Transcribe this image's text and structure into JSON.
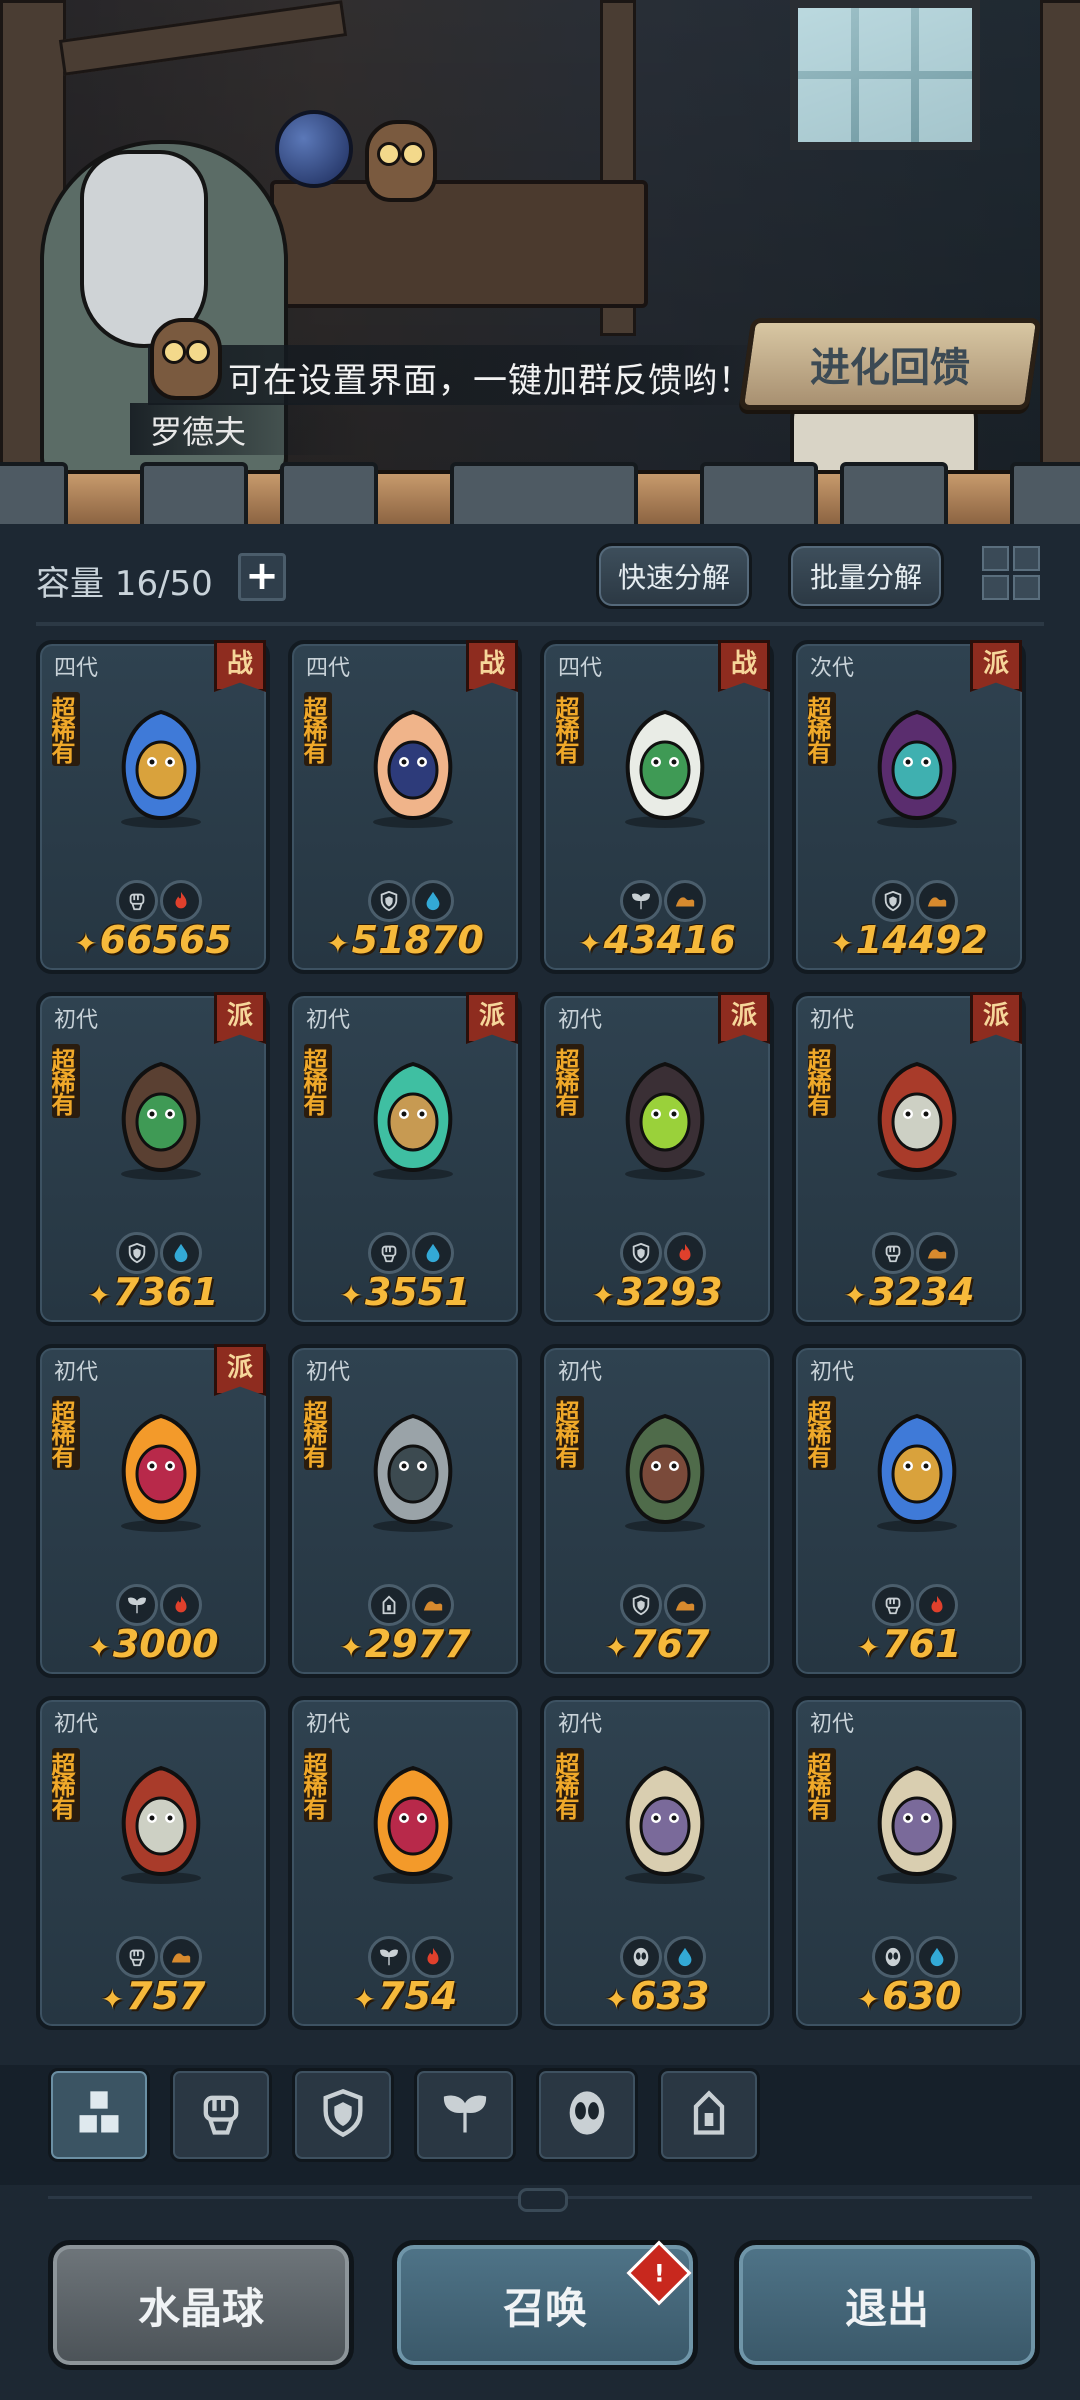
{
  "dialog": {
    "text": "可在设置界面，一键加群反馈哟！",
    "speaker": "罗德夫"
  },
  "evolution_button": "进化回馈",
  "toolbar": {
    "capacity_label": "容量 16/50",
    "quick_decompose": "快速分解",
    "batch_decompose": "批量分解"
  },
  "cards": [
    {
      "gen": "四代",
      "faction": "战",
      "rarity": "超稀有",
      "power": "66565",
      "elements": [
        "fist-icon",
        "fire-icon"
      ],
      "creature": "blue-flame-spirit"
    },
    {
      "gen": "四代",
      "faction": "战",
      "rarity": "超稀有",
      "power": "51870",
      "elements": [
        "shield-icon",
        "water-icon"
      ],
      "creature": "bunny-witch"
    },
    {
      "gen": "四代",
      "faction": "战",
      "rarity": "超稀有",
      "power": "43416",
      "elements": [
        "leaf-icon",
        "earth-icon"
      ],
      "creature": "white-owl-sage"
    },
    {
      "gen": "次代",
      "faction": "派",
      "rarity": "超稀有",
      "power": "14492",
      "elements": [
        "shield-icon",
        "earth-icon"
      ],
      "creature": "rose-dark-fairy"
    },
    {
      "gen": "初代",
      "faction": "派",
      "rarity": "超稀有",
      "power": "7361",
      "elements": [
        "shield-icon",
        "water-icon"
      ],
      "creature": "tree-spirit"
    },
    {
      "gen": "初代",
      "faction": "派",
      "rarity": "超稀有",
      "power": "3551",
      "elements": [
        "fist-icon",
        "water-icon"
      ],
      "creature": "water-serpent"
    },
    {
      "gen": "初代",
      "faction": "派",
      "rarity": "超稀有",
      "power": "3293",
      "elements": [
        "shield-icon",
        "fire-icon"
      ],
      "creature": "dark-beast"
    },
    {
      "gen": "初代",
      "faction": "派",
      "rarity": "超稀有",
      "power": "3234",
      "elements": [
        "fist-icon",
        "earth-icon"
      ],
      "creature": "hooded-blob"
    },
    {
      "gen": "初代",
      "faction": "派",
      "rarity": "超稀有",
      "power": "3000",
      "elements": [
        "leaf-icon",
        "fire-icon"
      ],
      "creature": "phoenix-fairy"
    },
    {
      "gen": "初代",
      "faction": "",
      "rarity": "超稀有",
      "power": "2977",
      "elements": [
        "tower-icon",
        "earth-icon"
      ],
      "creature": "armored-rat"
    },
    {
      "gen": "初代",
      "faction": "",
      "rarity": "超稀有",
      "power": "767",
      "elements": [
        "shield-icon",
        "earth-icon"
      ],
      "creature": "moss-golem"
    },
    {
      "gen": "初代",
      "faction": "",
      "rarity": "超稀有",
      "power": "761",
      "elements": [
        "fist-icon",
        "fire-icon"
      ],
      "creature": "blue-flame-spirit"
    },
    {
      "gen": "初代",
      "faction": "",
      "rarity": "超稀有",
      "power": "757",
      "elements": [
        "fist-icon",
        "earth-icon"
      ],
      "creature": "hooded-blob"
    },
    {
      "gen": "初代",
      "faction": "",
      "rarity": "超稀有",
      "power": "754",
      "elements": [
        "leaf-icon",
        "fire-icon"
      ],
      "creature": "phoenix-fairy"
    },
    {
      "gen": "初代",
      "faction": "",
      "rarity": "超稀有",
      "power": "633",
      "elements": [
        "alien-icon",
        "water-icon"
      ],
      "creature": "bone-dragon"
    },
    {
      "gen": "初代",
      "faction": "",
      "rarity": "超稀有",
      "power": "630",
      "elements": [
        "alien-icon",
        "water-icon"
      ],
      "creature": "bone-dragon"
    }
  ],
  "filters": [
    "all-icon",
    "fist-icon",
    "shield-icon",
    "leaf-icon",
    "alien-icon",
    "tower-icon"
  ],
  "bottom": {
    "crystal_ball": "水晶球",
    "summon": "召唤",
    "summon_alert": "!",
    "exit": "退出"
  },
  "colors": {
    "fire": "#e0402c",
    "water": "#33a9d6",
    "earth": "#d78a2e",
    "neutral": "#c9d0d4",
    "rarity": "#f0a92a",
    "power": "#f6b93b"
  }
}
